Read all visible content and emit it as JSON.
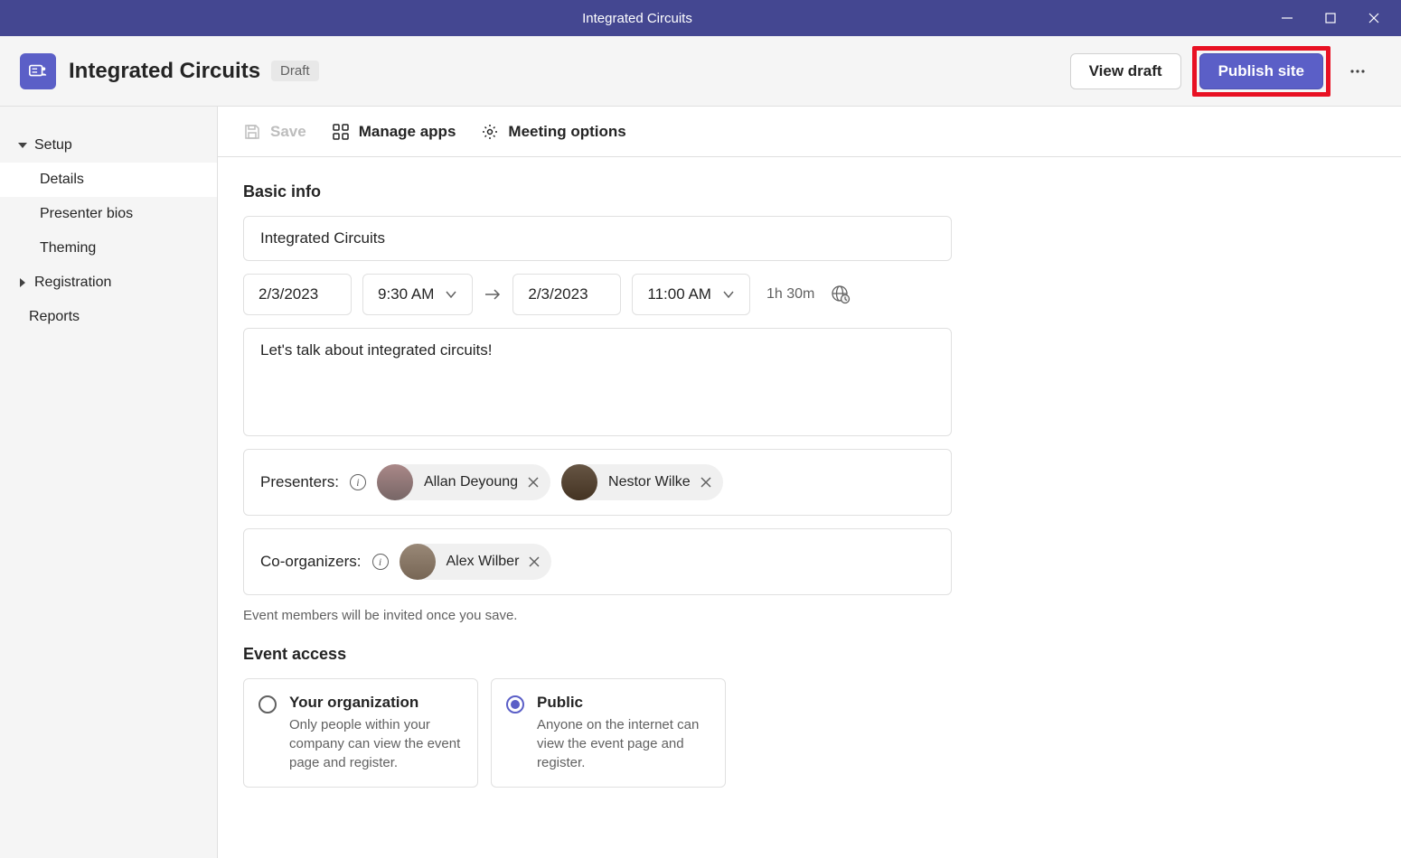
{
  "titlebar": {
    "title": "Integrated Circuits"
  },
  "header": {
    "title": "Integrated Circuits",
    "badge": "Draft",
    "view_draft": "View draft",
    "publish": "Publish site"
  },
  "sidebar": {
    "setup": "Setup",
    "details": "Details",
    "presenter_bios": "Presenter bios",
    "theming": "Theming",
    "registration": "Registration",
    "reports": "Reports"
  },
  "toolbar": {
    "save": "Save",
    "manage_apps": "Manage apps",
    "meeting_options": "Meeting options"
  },
  "form": {
    "basic_info_heading": "Basic info",
    "title_value": "Integrated Circuits",
    "start_date": "2/3/2023",
    "start_time": "9:30 AM",
    "end_date": "2/3/2023",
    "end_time": "11:00 AM",
    "duration": "1h 30m",
    "description": "Let's talk about integrated circuits!",
    "presenters_label": "Presenters:",
    "coorganizers_label": "Co-organizers:",
    "presenters": [
      {
        "name": "Allan Deyoung"
      },
      {
        "name": "Nestor Wilke"
      }
    ],
    "coorganizers": [
      {
        "name": "Alex Wilber"
      }
    ],
    "invite_hint": "Event members will be invited once you save.",
    "event_access_heading": "Event access",
    "access": {
      "org_title": "Your organization",
      "org_desc": "Only people within your company can view the event page and register.",
      "public_title": "Public",
      "public_desc": "Anyone on the internet can view the event page and register.",
      "selected": "public"
    }
  }
}
